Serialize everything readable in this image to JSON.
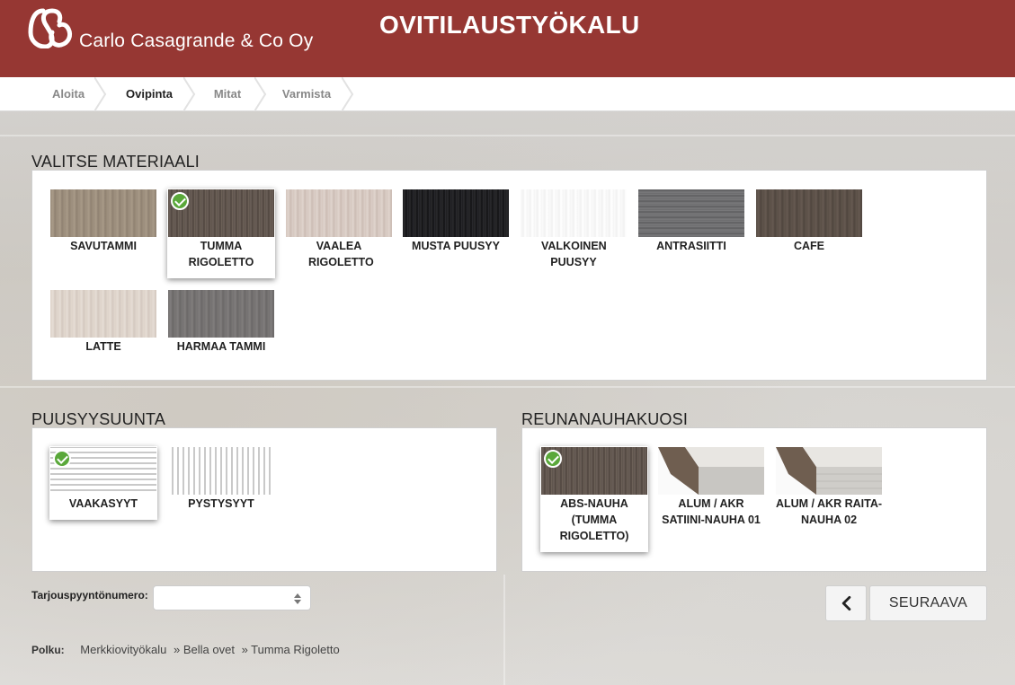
{
  "header": {
    "company": "Carlo Casagrande & Co Oy",
    "title": "OVITILAUSTYÖKALU",
    "brand_color": "#963733"
  },
  "steps": [
    "Aloita",
    "Ovipinta",
    "Mitat",
    "Varmista"
  ],
  "active_step": "Ovipinta",
  "material": {
    "title": "VALITSE MATERIAALI",
    "items": [
      {
        "label": "SAVUTAMMI",
        "selected": false
      },
      {
        "label": "TUMMA RIGOLETTO",
        "selected": true
      },
      {
        "label": "VAALEA RIGOLETTO",
        "selected": false
      },
      {
        "label": "MUSTA PUUSYY",
        "selected": false
      },
      {
        "label": "VALKOINEN PUUSYY",
        "selected": false
      },
      {
        "label": "ANTRASIITTI",
        "selected": false
      },
      {
        "label": "CAFE",
        "selected": false
      },
      {
        "label": "LATTE",
        "selected": false
      },
      {
        "label": "HARMAA TAMMI",
        "selected": false
      }
    ]
  },
  "grain": {
    "title": "PUUSYYSUUNTA",
    "items": [
      {
        "label": "VAAKASYYT",
        "selected": true
      },
      {
        "label": "PYSTYSYYT",
        "selected": false
      }
    ]
  },
  "edge": {
    "title": "REUNANAUHAKUOSI",
    "items": [
      {
        "label": "ABS-NAUHA (TUMMA RIGOLETTO)",
        "selected": true
      },
      {
        "label": "ALUM / AKR SATIINI-NAUHA 01",
        "selected": false
      },
      {
        "label": "ALUM / AKR RAITA-NAUHA 02",
        "selected": false
      }
    ]
  },
  "offer": {
    "label": "Tarjouspyyntönumero:",
    "value": "",
    "placeholder": ""
  },
  "nav": {
    "back_icon": "chevron-left-icon",
    "next_label": "SEURAAVA"
  },
  "path": {
    "label": "Polku:",
    "crumbs": [
      "Merkkiovityökalu",
      "» Bella ovet",
      "» Tumma Rigoletto"
    ]
  },
  "check_color": "#5aa83a"
}
